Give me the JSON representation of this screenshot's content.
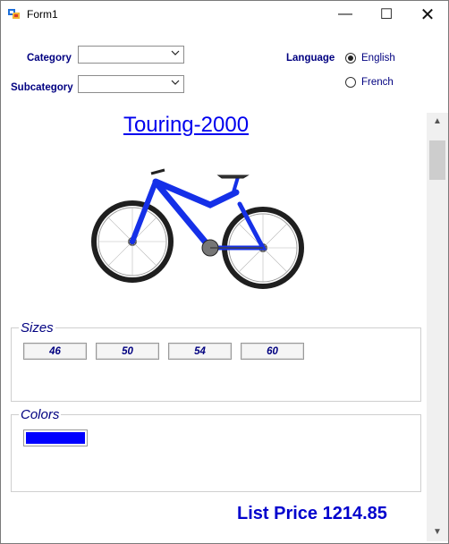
{
  "window": {
    "title": "Form1",
    "minimize_glyph": "—",
    "maximize_glyph": "☐",
    "close_glyph": "✕"
  },
  "filters": {
    "category_label": "Category",
    "category_value": "",
    "subcategory_label": "Subcategory",
    "subcategory_value": ""
  },
  "language": {
    "label": "Language",
    "options": [
      {
        "label": "English",
        "selected": true
      },
      {
        "label": "French",
        "selected": false
      }
    ]
  },
  "product": {
    "name": "Touring-2000",
    "image_icon": "mountain-bike-image",
    "sizes_title": "Sizes",
    "sizes": [
      "46",
      "50",
      "54",
      "60"
    ],
    "colors_title": "Colors",
    "colors": [
      {
        "name": "Blue",
        "hex": "#0000ff"
      }
    ],
    "price_text": "List Price 1214.85"
  },
  "theme": {
    "label_color": "#000080",
    "link_color": "#0000ee",
    "price_color": "#0000cd"
  },
  "scrollbar": {
    "up_glyph": "▲",
    "down_glyph": "▼"
  }
}
